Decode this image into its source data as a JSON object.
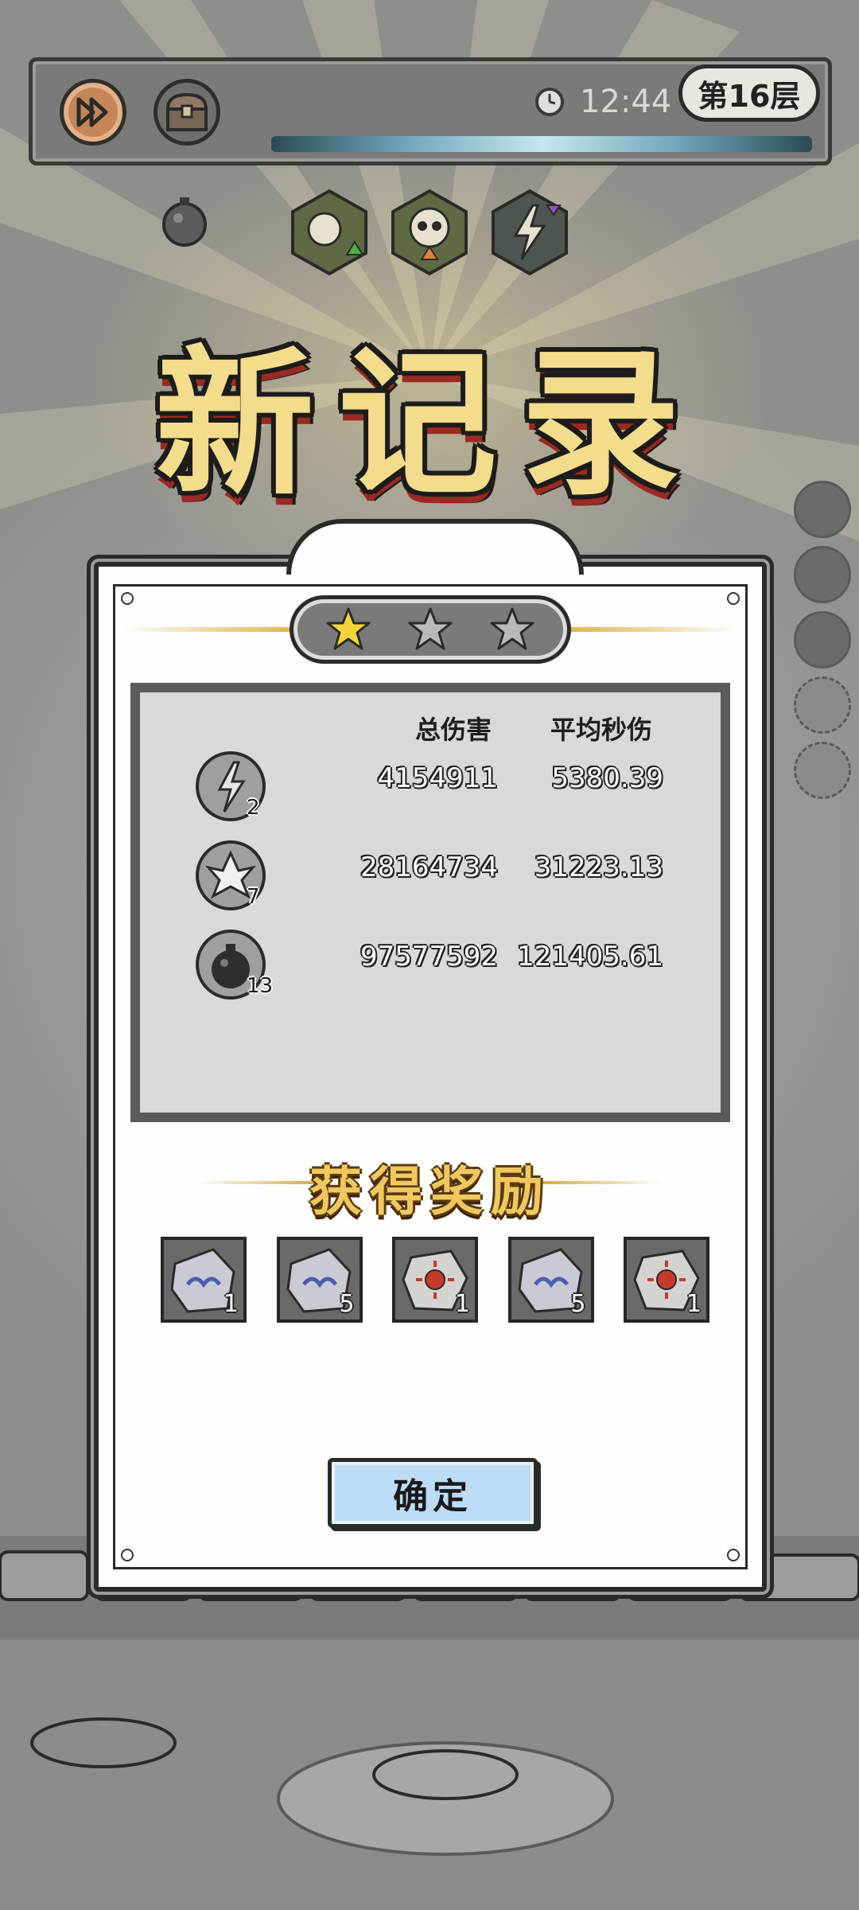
{
  "hud": {
    "timer": "12:44",
    "floor": "第16层",
    "buttons": [
      "fast-forward-icon",
      "chest-icon"
    ],
    "buffs": [
      "fist-up-icon",
      "skull-up-icon",
      "lightning-down-icon"
    ]
  },
  "title": "新记录",
  "result": {
    "stars_earned": 1,
    "stars_total": 3
  },
  "stats": {
    "headers": {
      "total": "总伤害",
      "dps": "平均秒伤"
    },
    "rows": [
      {
        "skill": "lightning-skill-icon",
        "level": "2",
        "total": "4154911",
        "dps": "5380.39"
      },
      {
        "skill": "shard-skill-icon",
        "level": "7",
        "total": "28164734",
        "dps": "31223.13"
      },
      {
        "skill": "bomb-skill-icon",
        "level": "13",
        "total": "97577592",
        "dps": "121405.61"
      }
    ]
  },
  "rewards": {
    "title": "获得奖励",
    "items": [
      {
        "icon": "rune-stone-icon",
        "count": "1"
      },
      {
        "icon": "rune-stone-icon",
        "count": "5"
      },
      {
        "icon": "sun-gem-icon",
        "count": "1"
      },
      {
        "icon": "rune-stone-icon",
        "count": "5"
      },
      {
        "icon": "sun-gem-icon",
        "count": "1"
      }
    ]
  },
  "confirm_label": "确定",
  "colors": {
    "title_gold": "#f3dc8c",
    "star_gold": "#f5d43a",
    "confirm_blue": "#bcdcf8",
    "accent_red": "#9b2a22"
  }
}
